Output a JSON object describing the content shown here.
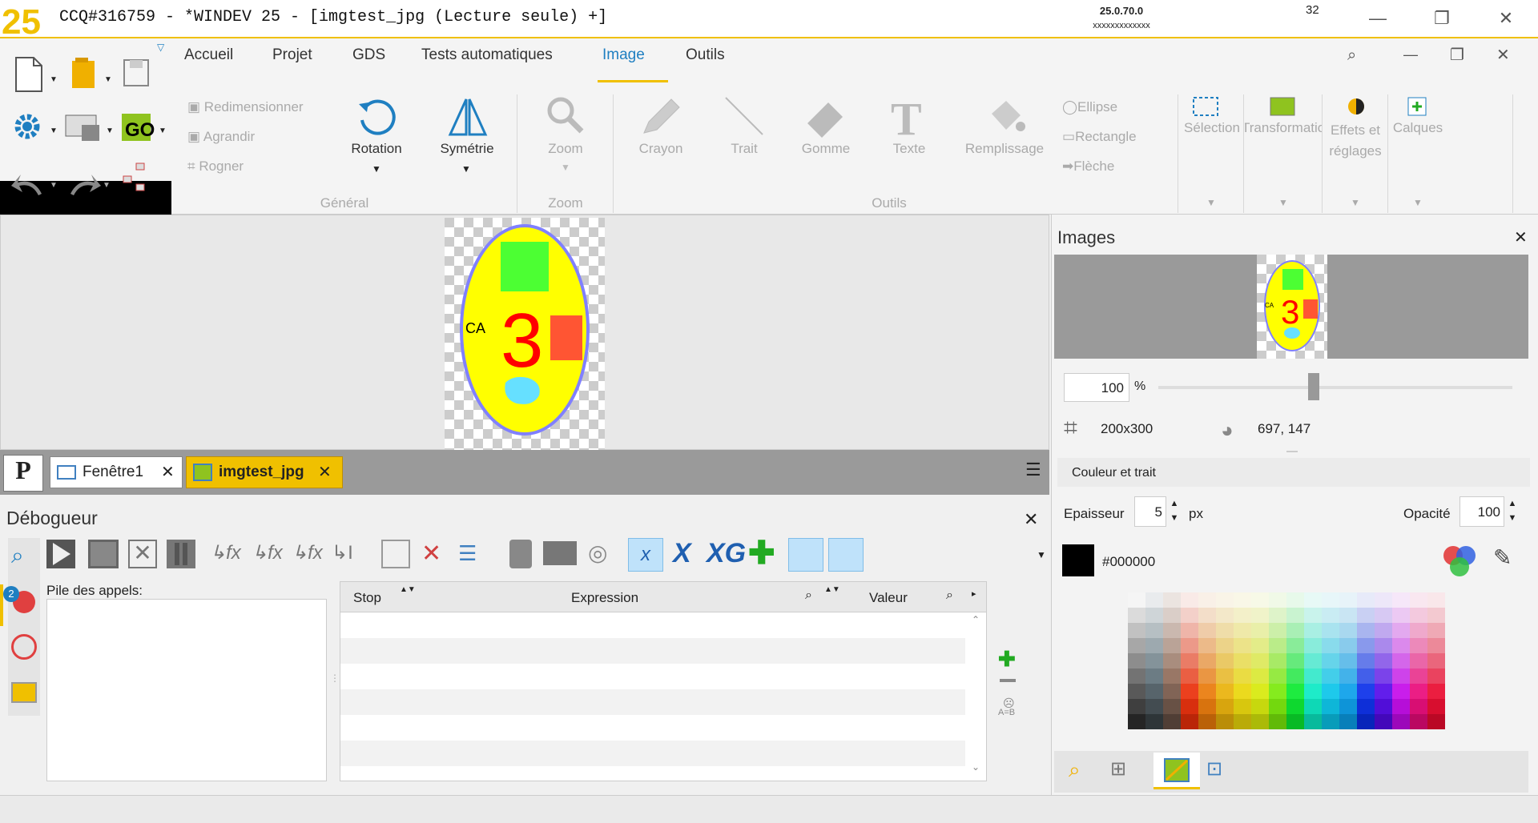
{
  "window": {
    "title": "CCQ#316759 - *WINDEV 25 - [imgtest_jpg (Lecture seule) +]",
    "version": "25.0.70.0",
    "version_sub": "xxxxxxxxxxxxx",
    "badge": "32",
    "logo_text": "25"
  },
  "ribbon": {
    "tabs": [
      "Accueil",
      "Projet",
      "GDS",
      "Tests automatiques",
      "Image",
      "Outils"
    ],
    "active_tab": "Image",
    "general": {
      "label": "Général",
      "small_items": [
        "Redimensionner",
        "Agrandir",
        "Rogner"
      ],
      "rotation": "Rotation",
      "symetrie": "Symétrie"
    },
    "zoom": {
      "label": "Zoom",
      "button": "Zoom"
    },
    "outils": {
      "label": "Outils",
      "items": [
        "Crayon",
        "Trait",
        "Gomme",
        "Texte",
        "Remplissage"
      ],
      "shapes": [
        "Ellipse",
        "Rectangle",
        "Flèche"
      ]
    },
    "right_items": [
      "Sélection",
      "Transformation",
      "Effets et réglages",
      "Calques"
    ]
  },
  "image": {
    "ca_text": "CA",
    "number": "3",
    "colors": {
      "oval": "#ffff00",
      "outline": "#8080ff",
      "green": "#4cff33",
      "red": "#ff5533",
      "cyan": "#66e0ff",
      "number": "#ff0000"
    }
  },
  "doctabs": {
    "p_icon": "P",
    "tabs": [
      "Fenêtre1",
      "imgtest_jpg"
    ],
    "active": "imgtest_jpg"
  },
  "debugger": {
    "title": "Débogueur",
    "badge_count": "2",
    "callstack_label": "Pile des appels:",
    "columns": [
      "Stop",
      "Expression",
      "Valeur"
    ],
    "ab_label": "A=B"
  },
  "images_panel": {
    "title": "Images",
    "zoom_value": "100",
    "zoom_unit": "%",
    "zoom_fraction": 0.5,
    "size": "200x300",
    "coords": "697, 147",
    "section": "Couleur et trait",
    "epaisseur_label": "Epaisseur",
    "epaisseur_value": "5",
    "epaisseur_unit": "px",
    "opacite_label": "Opacité",
    "opacite_value": "100",
    "color_hex": "#000000"
  },
  "accent": "#f0c000",
  "active_blue": "#1f7fc1"
}
